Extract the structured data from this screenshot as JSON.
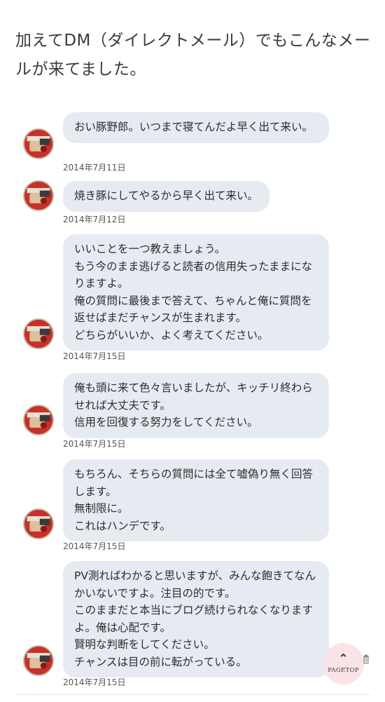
{
  "intro": {
    "text": "加えてDM（ダイレクトメール）でもこんなメールが来てました。"
  },
  "messages": [
    {
      "text": "おい豚野郎。いつまで寝てんだよ早く出て来い。",
      "date": "2014年7月11日"
    },
    {
      "text": "焼き豚にしてやるから早く出て来い。",
      "date": "2014年7月12日"
    },
    {
      "text": "いいことを一つ教えましょう。\nもう今のまま逃げると読者の信用失ったままになりますよ。\n俺の質問に最後まで答えて、ちゃんと俺に質問を返せばまだチャンスが生まれます。\nどちらがいいか、よく考えてください。",
      "date": "2014年7月15日"
    },
    {
      "text": "俺も頭に来て色々言いましたが、キッチリ終わらせれば大丈夫です。\n信用を回復する努力をしてください。",
      "date": "2014年7月15日"
    },
    {
      "text": "もちろん、そちらの質問には全て嘘偽り無く回答します。\n無制限に。\nこれはハンデです。",
      "date": "2014年7月15日"
    },
    {
      "text": "PV測ればわかると思いますが、みんな飽きてなんかいないですよ。注目の的です。\nこのままだと本当にブログ続けられなくなりますよ。俺は心配です。\n賢明な判断をしてください。\nチャンスは目の前に転がっている。",
      "date": "2014年7月15日"
    }
  ],
  "pagetop": {
    "label": "PAGETOP",
    "icon": "chevron-up-icon"
  },
  "colors": {
    "bubble": "#e6ebf2",
    "pagetop_bg": "#fbe4e8",
    "avatar_red": "#c8302a"
  }
}
